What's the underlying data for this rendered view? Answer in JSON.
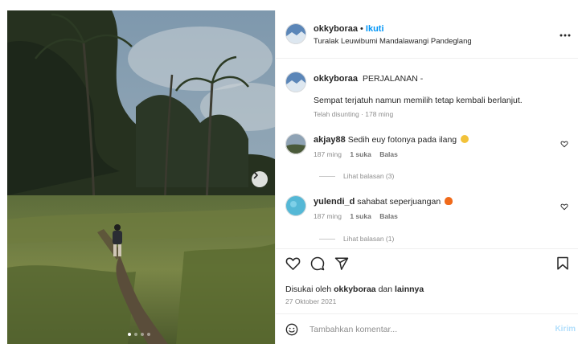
{
  "post": {
    "username": "okkyboraa",
    "separator": "•",
    "follow_label": "Ikuti",
    "location": "Turalak Leuwibumi Mandalawangi Pandeglang",
    "more_label": "•••"
  },
  "caption": {
    "username": "okkyboraa",
    "line1": "PERJALANAN -",
    "line2": "Sempat terjatuh namun memilih tetap kembali berlanjut.",
    "meta": "Telah disunting · 178 ming"
  },
  "comments": [
    {
      "username": "akjay88",
      "text": "Sedih euy fotonya pada ilang",
      "emoji": "sad-face-emoji",
      "time": "187 ming",
      "likes": "1 suka",
      "reply_label": "Balas",
      "view_replies": "Lihat balasan (3)"
    },
    {
      "username": "yulendi_d",
      "text": "sahabat seperjuangan",
      "emoji": "fire-emoji",
      "time": "187 ming",
      "likes": "1 suka",
      "reply_label": "Balas",
      "view_replies": "Lihat balasan (1)"
    }
  ],
  "actions": {
    "icons": [
      "heart-icon",
      "comment-icon",
      "share-icon",
      "bookmark-icon"
    ],
    "liked_by_prefix": "Disukai oleh",
    "liked_by_user": "okkyboraa",
    "liked_by_joiner": "dan",
    "liked_by_others": "lainnya",
    "date": "27 Oktober 2021"
  },
  "comment_box": {
    "placeholder": "Tambahkan komentar...",
    "post_label": "Kirim"
  },
  "carousel": {
    "current": 1,
    "total": 4
  },
  "colors": {
    "follow": "#0095f6",
    "post_disabled": "#b2dffc",
    "muted": "#8e8e8e"
  }
}
